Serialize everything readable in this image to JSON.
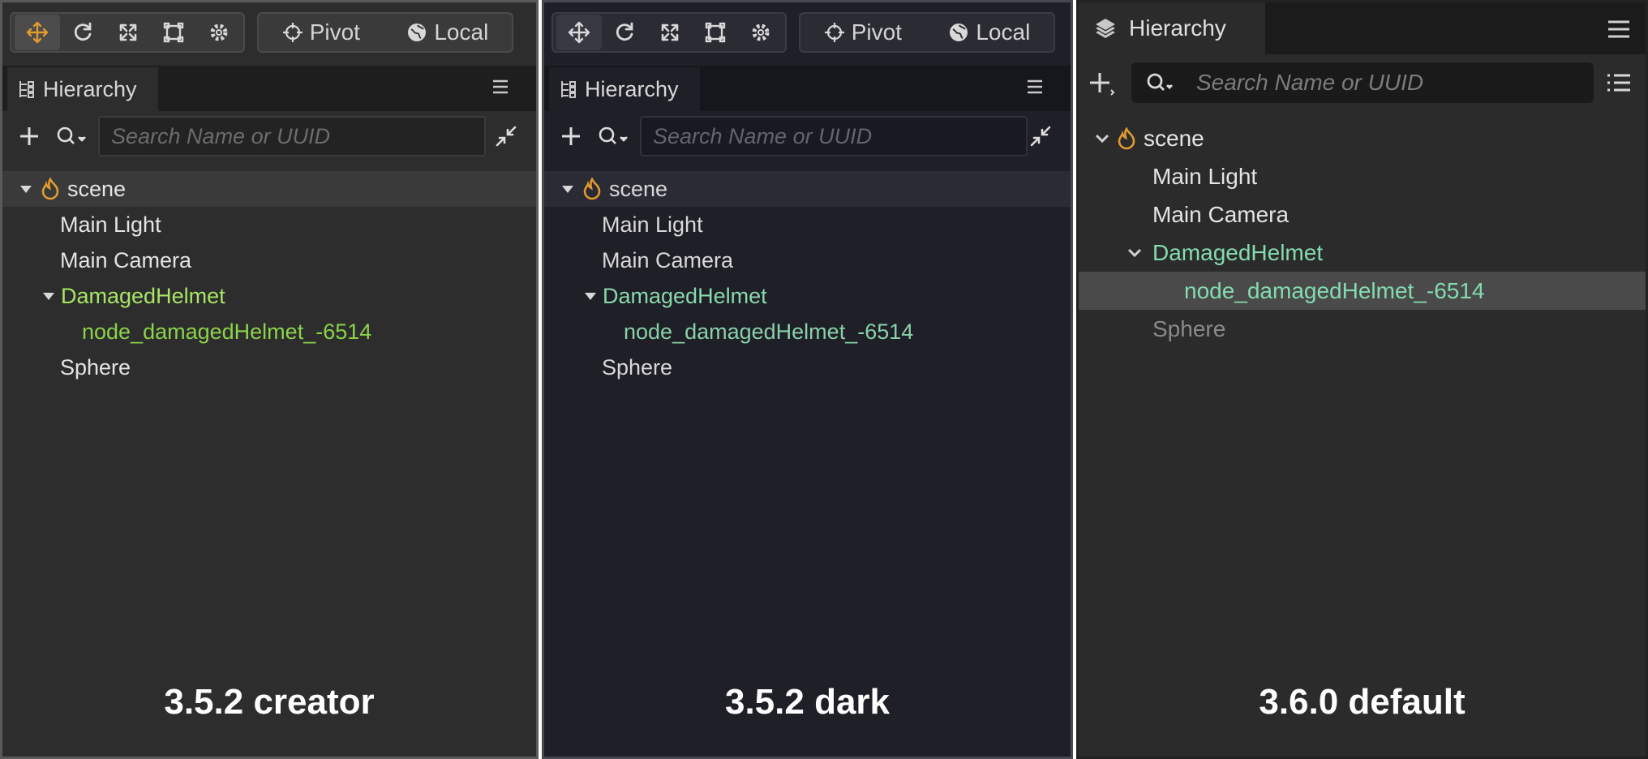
{
  "toolbar": {
    "pivot_label": "Pivot",
    "local_label": "Local",
    "tools": [
      "move-icon",
      "rotate-icon",
      "scale-icon",
      "rect-icon",
      "gear-icon"
    ]
  },
  "hierarchy": {
    "title": "Hierarchy",
    "search_placeholder": "Search Name or UUID"
  },
  "tree": {
    "scene": "scene",
    "main_light": "Main Light",
    "main_camera": "Main Camera",
    "damaged_helmet": "DamagedHelmet",
    "node_helmet": "node_damagedHelmet_-6514",
    "sphere": "Sphere"
  },
  "panels": [
    {
      "caption": "3.5.2 creator"
    },
    {
      "caption": "3.5.2 dark"
    },
    {
      "caption": "3.6.0 default"
    }
  ],
  "colors": {
    "accent_orange": "#e39a2f",
    "creator_selected_green": "#a8e564",
    "dark_selected_green": "#8ad8ac",
    "default_selected_green": "#84dbb0"
  }
}
